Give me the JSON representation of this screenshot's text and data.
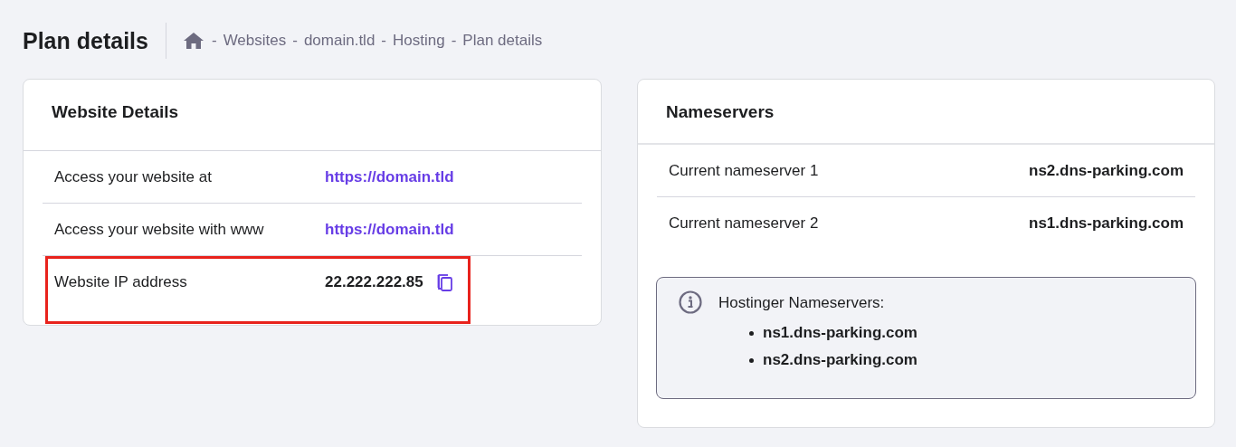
{
  "page_title": "Plan details",
  "breadcrumb": [
    {
      "separator": "-",
      "label": "Websites"
    },
    {
      "separator": "-",
      "label": "domain.tld"
    },
    {
      "separator": "-",
      "label": "Hosting"
    },
    {
      "separator": "-",
      "label": "Plan details"
    }
  ],
  "website_details": {
    "title": "Website Details",
    "rows": [
      {
        "label": "Access your website at",
        "value": "https://domain.tld",
        "kind": "link",
        "highlighted": false
      },
      {
        "label": "Access your website with www",
        "value": "https://domain.tld",
        "kind": "link",
        "highlighted": false
      },
      {
        "label": "Website IP address",
        "value": "22.222.222.85",
        "kind": "copyable",
        "highlighted": true
      }
    ]
  },
  "nameservers": {
    "title": "Nameservers",
    "rows": [
      {
        "label": "Current nameserver 1",
        "value": "ns2.dns-parking.com"
      },
      {
        "label": "Current nameserver 2",
        "value": "ns1.dns-parking.com"
      }
    ],
    "info": {
      "heading": "Hostinger Nameservers:",
      "items": [
        "ns1.dns-parking.com",
        "ns2.dns-parking.com"
      ]
    }
  }
}
